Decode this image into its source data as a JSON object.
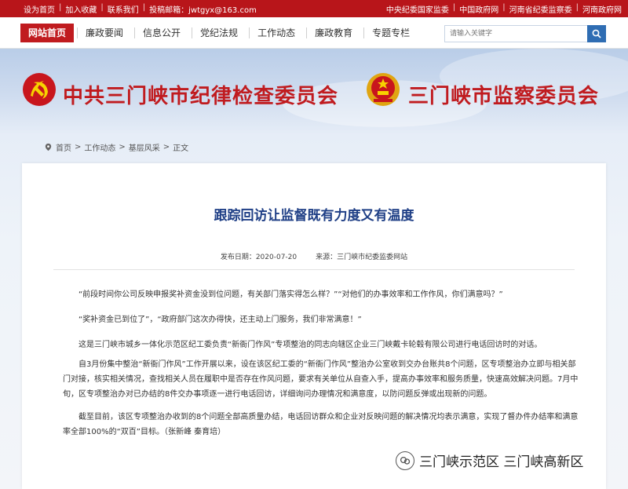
{
  "topbar": {
    "left_links": [
      "设为首页",
      "加入收藏",
      "联系我们"
    ],
    "email_label": "投稿邮箱：jwtgyx@163.com",
    "right_links": [
      "中央纪委国家监委",
      "中国政府网",
      "河南省纪委监察委",
      "河南政府网"
    ]
  },
  "nav": {
    "home": "网站首页",
    "items": [
      "廉政要闻",
      "信息公开",
      "党纪法规",
      "工作动态",
      "廉政教育",
      "专题专栏"
    ],
    "search_placeholder": "请输入关键字"
  },
  "banner": {
    "title_left": "中共三门峡市纪律检查委员会",
    "title_right": "三门峡市监察委员会"
  },
  "breadcrumb": [
    "首页",
    "工作动态",
    "基层风采",
    "正文"
  ],
  "article": {
    "title": "跟踪回访让监督既有力度又有温度",
    "date": "发布日期：2020-07-20",
    "source": "来源：三门峡市纪委监委网站",
    "paragraphs": [
      "“前段时间你公司反映申报奖补资金没到位问题，有关部门落实得怎么样？”“对他们的办事效率和工作作风，你们满意吗？”",
      "“奖补资金已到位了”，“政府部门这次办得快，还主动上门服务，我们非常满意！”",
      "这是三门峡市城乡一体化示范区纪工委负责“新衙门作风”专项整治的同志向辖区企业三门峡戴卡轮毂有限公司进行电话回访时的对话。",
      "自3月份集中整治“新衙门作风”工作开展以来，设在该区纪工委的“新衙门作风”整治办公室收到交办台账共8个问题，区专项整治办立即与相关部门对接，核实相关情况，查找相关人员在履职中是否存在作风问题，要求有关单位从自查入手，提高办事效率和服务质量，快速高效解决问题。7月中旬，区专项整治办对已办结的8件交办事项逐一进行电话回访，详细询问办理情况和满意度，以防问题反弹或出现新的问题。",
      "截至目前，该区专项整治办收到的8个问题全部高质量办结，电话回访群众和企业对反映问题的解决情况均表示满意，实现了督办件办结率和满意率全部100%的“双百”目标。（张新峰 秦育培）"
    ]
  },
  "watermark": "三门峡示范区 三门峡高新区",
  "colors": {
    "red": "#c01b1f",
    "title_blue": "#1f3f86",
    "search_blue": "#2f6db3"
  }
}
